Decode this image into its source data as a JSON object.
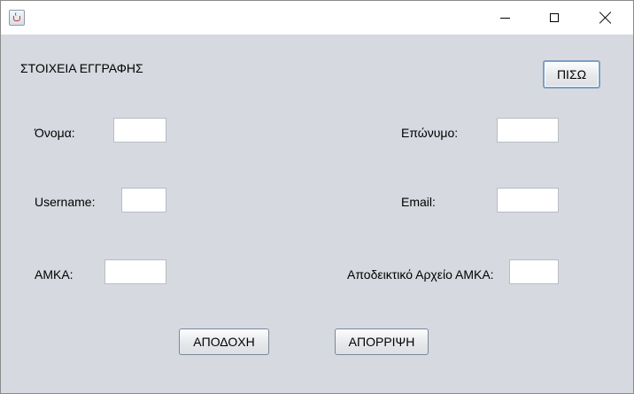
{
  "titlebar": {
    "app_icon": "java-cup-icon",
    "controls": [
      "minimize-icon",
      "maximize-icon",
      "close-icon"
    ]
  },
  "form": {
    "heading": "ΣΤΟΙΧΕΙΑ ΕΓΓΡΑΦΗΣ",
    "back_button": "ΠΙΣΩ",
    "fields": {
      "first_name": {
        "label": "Όνομα:",
        "value": ""
      },
      "last_name": {
        "label": "Επώνυμο:",
        "value": ""
      },
      "username": {
        "label": "Username:",
        "value": ""
      },
      "email": {
        "label": "Email:",
        "value": ""
      },
      "amka": {
        "label": "ΑΜΚΑ:",
        "value": ""
      },
      "amka_proof": {
        "label": "Αποδεικτικό Αρχείο ΑΜΚΑ:",
        "value": ""
      }
    },
    "accept_button": "ΑΠΟΔΟΧΗ",
    "reject_button": "ΑΠΟΡΡΙΨΗ"
  },
  "colors": {
    "panel_background": "#d6d9df",
    "focus_border": "#7d9fc4"
  }
}
